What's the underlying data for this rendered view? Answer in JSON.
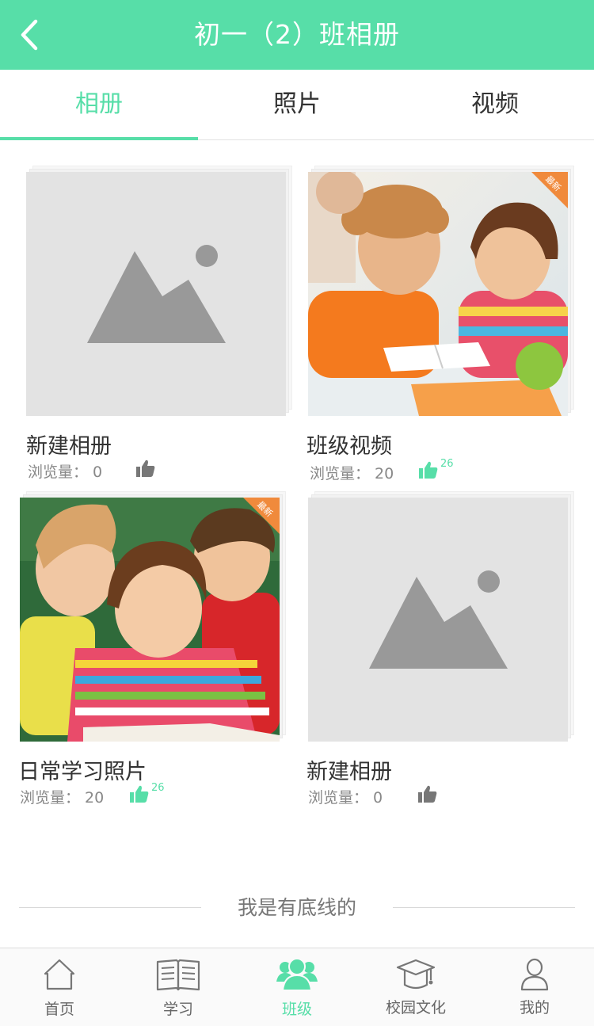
{
  "header": {
    "title": "初一（2）班相册",
    "back_icon": "chevron-left-icon",
    "bg_color": "#57DEA8"
  },
  "tabs": [
    {
      "label": "相册",
      "active": true
    },
    {
      "label": "照片",
      "active": false
    },
    {
      "label": "视频",
      "active": false
    }
  ],
  "albums": [
    {
      "title": "新建相册",
      "views_label": "浏览量：",
      "views": "0",
      "likes": "",
      "liked": false,
      "badge": "",
      "cover": "placeholder-image"
    },
    {
      "title": "班级视频",
      "views_label": "浏览量：",
      "views": "20",
      "likes": "26",
      "liked": true,
      "badge": "最新",
      "cover": "children-studying-photo"
    },
    {
      "title": "日常学习照片",
      "views_label": "浏览量：",
      "views": "20",
      "likes": "26",
      "liked": true,
      "badge": "最新",
      "cover": "children-reading-photo"
    },
    {
      "title": "新建相册",
      "views_label": "浏览量：",
      "views": "0",
      "likes": "",
      "liked": false,
      "badge": "",
      "cover": "placeholder-image"
    }
  ],
  "footer_text": "我是有底线的",
  "bottom_nav": [
    {
      "label": "首页",
      "icon": "home-icon",
      "active": false
    },
    {
      "label": "学习",
      "icon": "book-icon",
      "active": false
    },
    {
      "label": "班级",
      "icon": "class-group-icon",
      "active": true
    },
    {
      "label": "校园文化",
      "icon": "graduation-cap-icon",
      "active": false
    },
    {
      "label": "我的",
      "icon": "user-icon",
      "active": false
    }
  ],
  "colors": {
    "accent": "#57DEA8",
    "badge": "#F08A3C",
    "like_inactive": "#777777"
  }
}
